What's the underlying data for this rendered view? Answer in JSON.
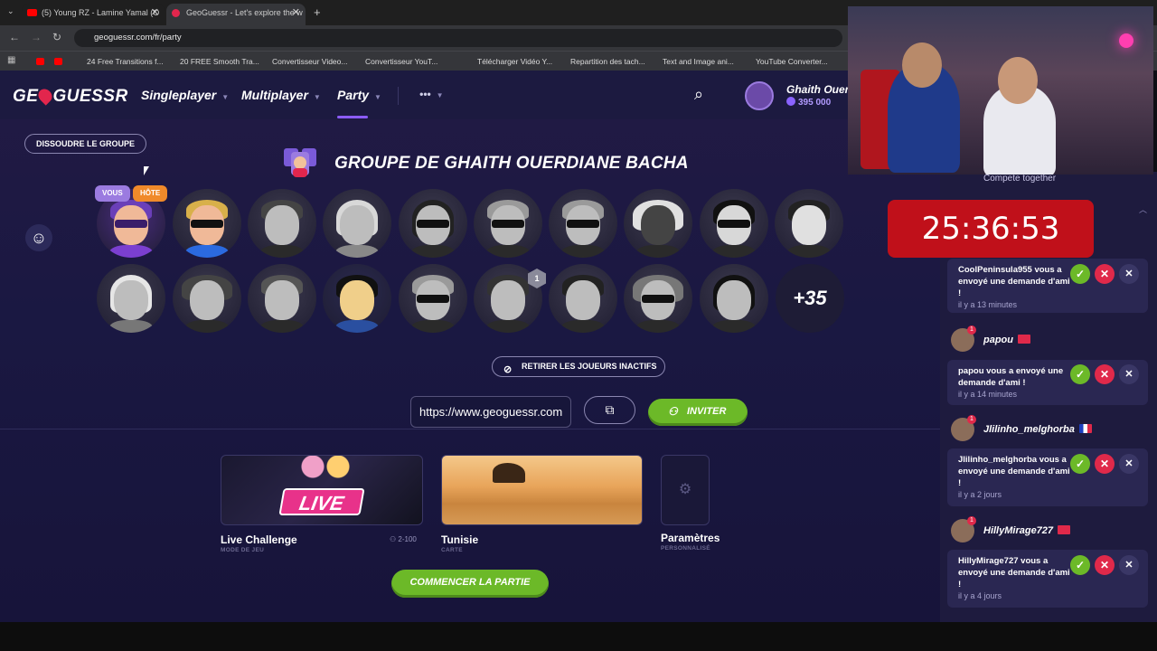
{
  "browser": {
    "tabs": [
      {
        "title": "(5) Young RZ - Lamine Yamal (O"
      },
      {
        "title": "GeoGuessr - Let's explore the w"
      }
    ],
    "url": "geoguessr.com/fr/party",
    "bookmarks": [
      "24 Free Transitions f...",
      "20 FREE Smooth Tra...",
      "Convertisseur Video...",
      "Convertisseur YouT...",
      "Télécharger Vidéo Y...",
      "Repartition des tach...",
      "Text and Image ani...",
      "YouTube Converter..."
    ]
  },
  "header": {
    "logo": "GEOGUESSR",
    "nav": {
      "singleplayer": "Singleplayer",
      "multiplayer": "Multiplayer",
      "party": "Party",
      "more": "•••"
    },
    "profile": {
      "name": "Ghaith Ouerd",
      "points": "395 000"
    }
  },
  "party": {
    "dissolve_label": "DISSOUDRE LE GROUPE",
    "title": "GROUPE DE GHAITH OUERDIANE BACHA",
    "badge_you": "VOUS",
    "badge_host": "HÔTE",
    "extra_players": "+35",
    "level_badge": "1",
    "remove_inactive_label": "RETIRER LES JOUEURS INACTIFS",
    "invite_link": "https://www.geoguessr.com",
    "invite_label": "INVITER",
    "start_label": "COMMENCER LA PARTIE"
  },
  "cards": {
    "live": {
      "badge": "LIVE",
      "title": "Live Challenge",
      "subtitle": "MODE DE JEU",
      "players": "2-100"
    },
    "map": {
      "title": "Tunisie",
      "subtitle": "CARTE"
    },
    "settings": {
      "title": "Paramètres",
      "subtitle": "PERSONNALISÉ"
    }
  },
  "side": {
    "compete": "Compete together",
    "timer": "25:36:53",
    "notifications": [
      {
        "user": "CoolPeninsula955",
        "text": "CoolPeninsula955 vous a envoyé une demande d'ami !",
        "time": "il y a 13 minutes"
      },
      {
        "user": "papou",
        "text": "papou vous a envoyé une demande d'ami !",
        "time": "il y a 14 minutes"
      },
      {
        "user": "Jlilinho_melghorba",
        "text": "Jlilinho_melghorba vous a envoyé une demande d'ami !",
        "time": "il y a 2 jours"
      },
      {
        "user": "HillyMirage727",
        "text": "HillyMirage727 vous a envoyé une demande d'ami !",
        "time": "il y a 4 jours"
      }
    ]
  }
}
